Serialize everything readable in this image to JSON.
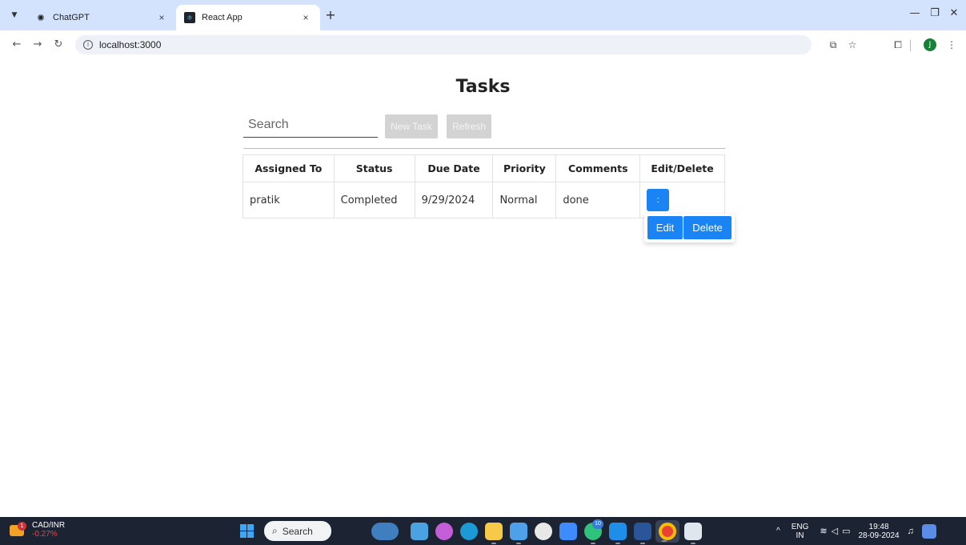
{
  "browser": {
    "tabs": [
      {
        "title": "ChatGPT",
        "favicon": "chatgpt-icon",
        "active": false
      },
      {
        "title": "React App",
        "favicon": "react-icon",
        "active": true
      }
    ],
    "tab_close_glyph": "×",
    "new_tab_glyph": "+",
    "address": "localhost:3000",
    "profile_initial": "J",
    "colors": {
      "tabstrip": "#d3e3fd",
      "omnibox": "#eef1f8"
    }
  },
  "app": {
    "title": "Tasks",
    "search_placeholder": "Search",
    "new_task_label": "New Task",
    "refresh_label": "Refresh",
    "columns": [
      "Assigned To",
      "Status",
      "Due Date",
      "Priority",
      "Comments",
      "Edit/Delete"
    ],
    "rows": [
      {
        "assigned_to": "pratik",
        "status": "Completed",
        "due_date": "9/29/2024",
        "priority": "Normal",
        "comments": "done"
      }
    ],
    "menu_glyph": ":",
    "edit_label": "Edit",
    "delete_label": "Delete",
    "colors": {
      "primary": "#1a84f5",
      "disabled": "#d3d3d3"
    }
  },
  "taskbar": {
    "widget_title": "CAD/INR",
    "widget_change": "-0.27%",
    "widget_badge": "1",
    "search_label": "Search",
    "lang_line1": "ENG",
    "lang_line2": "IN",
    "time": "19:48",
    "date": "28-09-2024",
    "copilot_badge": "10",
    "colors": {
      "background": "#1c2333"
    }
  }
}
